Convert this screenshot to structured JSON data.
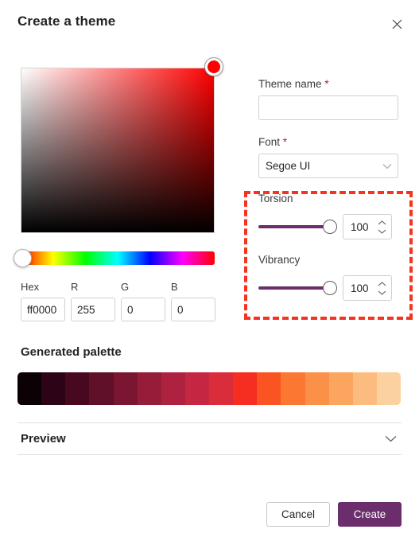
{
  "dialog": {
    "title": "Create a theme",
    "close_icon": "close-icon"
  },
  "color_picker": {
    "selected_color": "#ff0000",
    "hue_value": 0,
    "sv_thumb_color": "#ff0000",
    "fields": [
      {
        "label": "Hex",
        "value": "ff0000",
        "name": "hex"
      },
      {
        "label": "R",
        "value": "255",
        "name": "red"
      },
      {
        "label": "G",
        "value": "0",
        "name": "green"
      },
      {
        "label": "B",
        "value": "0",
        "name": "blue"
      }
    ]
  },
  "form": {
    "theme_name": {
      "label": "Theme name",
      "required_marker": "*",
      "value": "",
      "placeholder": ""
    },
    "font": {
      "label": "Font",
      "required_marker": "*",
      "selected": "Segoe UI",
      "chevron_icon": "chevron-down-icon"
    }
  },
  "sliders": [
    {
      "label": "Torsion",
      "value": "100",
      "fill_percent": 100,
      "track_color": "#6b2d6b"
    },
    {
      "label": "Vibrancy",
      "value": "100",
      "fill_percent": 100,
      "track_color": "#6b2d6b"
    }
  ],
  "annotation": {
    "color": "#f5341f",
    "style": "dashed-rectangle",
    "targets": [
      "Torsion",
      "Vibrancy"
    ]
  },
  "palette": {
    "title": "Generated palette",
    "colors": [
      "#0c0104",
      "#2d0417",
      "#48081f",
      "#611029",
      "#7a1632",
      "#951d3a",
      "#ae2240",
      "#c52742",
      "#db2c3c",
      "#f52e21",
      "#fa5423",
      "#fb7732",
      "#fb9049",
      "#fba55f",
      "#fcbc80",
      "#fcd1a0"
    ]
  },
  "preview": {
    "label": "Preview",
    "chevron_icon": "chevron-down-icon",
    "expanded": false
  },
  "footer": {
    "cancel_label": "Cancel",
    "create_label": "Create",
    "primary_color": "#6b2d6b"
  }
}
